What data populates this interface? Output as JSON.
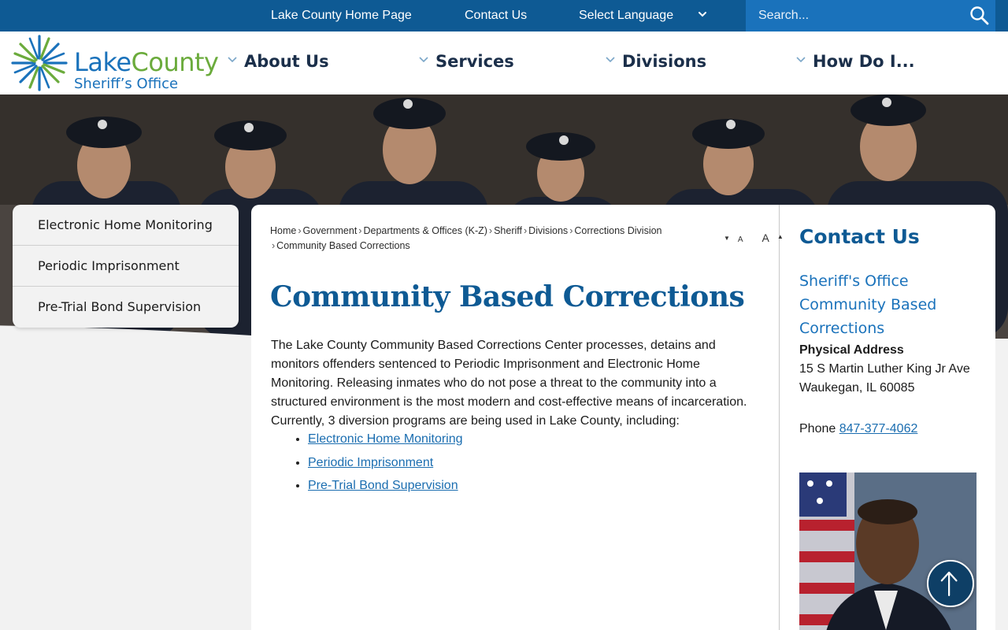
{
  "topbar": {
    "home_link": "Lake County Home Page",
    "contact_link": "Contact Us",
    "language_label": "Select Language",
    "search_placeholder": "Search..."
  },
  "logo": {
    "word1": "Lake",
    "word2": "County",
    "subtitle": "Sheriff’s Office"
  },
  "nav": [
    {
      "label": "About Us"
    },
    {
      "label": "Services"
    },
    {
      "label": "Divisions"
    },
    {
      "label": "How Do I..."
    }
  ],
  "subnav": [
    {
      "label": "Electronic Home Monitoring"
    },
    {
      "label": "Periodic Imprisonment"
    },
    {
      "label": "Pre-Trial Bond Supervision"
    }
  ],
  "breadcrumb": [
    "Home",
    "Government",
    "Departments & Offices (K-Z)",
    "Sheriff",
    "Divisions",
    "Corrections Division",
    "Community Based Corrections"
  ],
  "font_controls": {
    "decrease": "A",
    "increase": "A"
  },
  "main": {
    "title": "Community Based Corrections",
    "body": "The Lake County Community Based Corrections Center processes, detains and monitors offenders sentenced to Periodic Imprisonment and Electronic Home Monitoring. Releasing inmates who do not pose a threat to the community into a structured environment is the most modern and cost-effective means of incarceration. Currently, 3 diversion programs are being used in Lake County, including:",
    "programs": [
      "Electronic Home Monitoring",
      "Periodic Imprisonment",
      "Pre-Trial Bond Supervision"
    ]
  },
  "contact": {
    "title": "Contact Us",
    "org_line1": "Sheriff's Office",
    "org_line2": "Community Based",
    "org_line3": "Corrections",
    "address_label": "Physical Address",
    "address_line1": "15 S Martin Luther King Jr Ave",
    "address_line2": "Waukegan, IL 60085",
    "phone_label": "Phone",
    "phone": "847-377-4062"
  },
  "colors": {
    "brand_blue": "#0e5a94",
    "link_blue": "#1a6db0",
    "brand_green": "#6bab3c",
    "nav_text": "#1b2f4a"
  },
  "icons": [
    "search-icon",
    "chevron-down-icon",
    "arrow-up-icon",
    "font-decrease-icon",
    "font-increase-icon"
  ]
}
